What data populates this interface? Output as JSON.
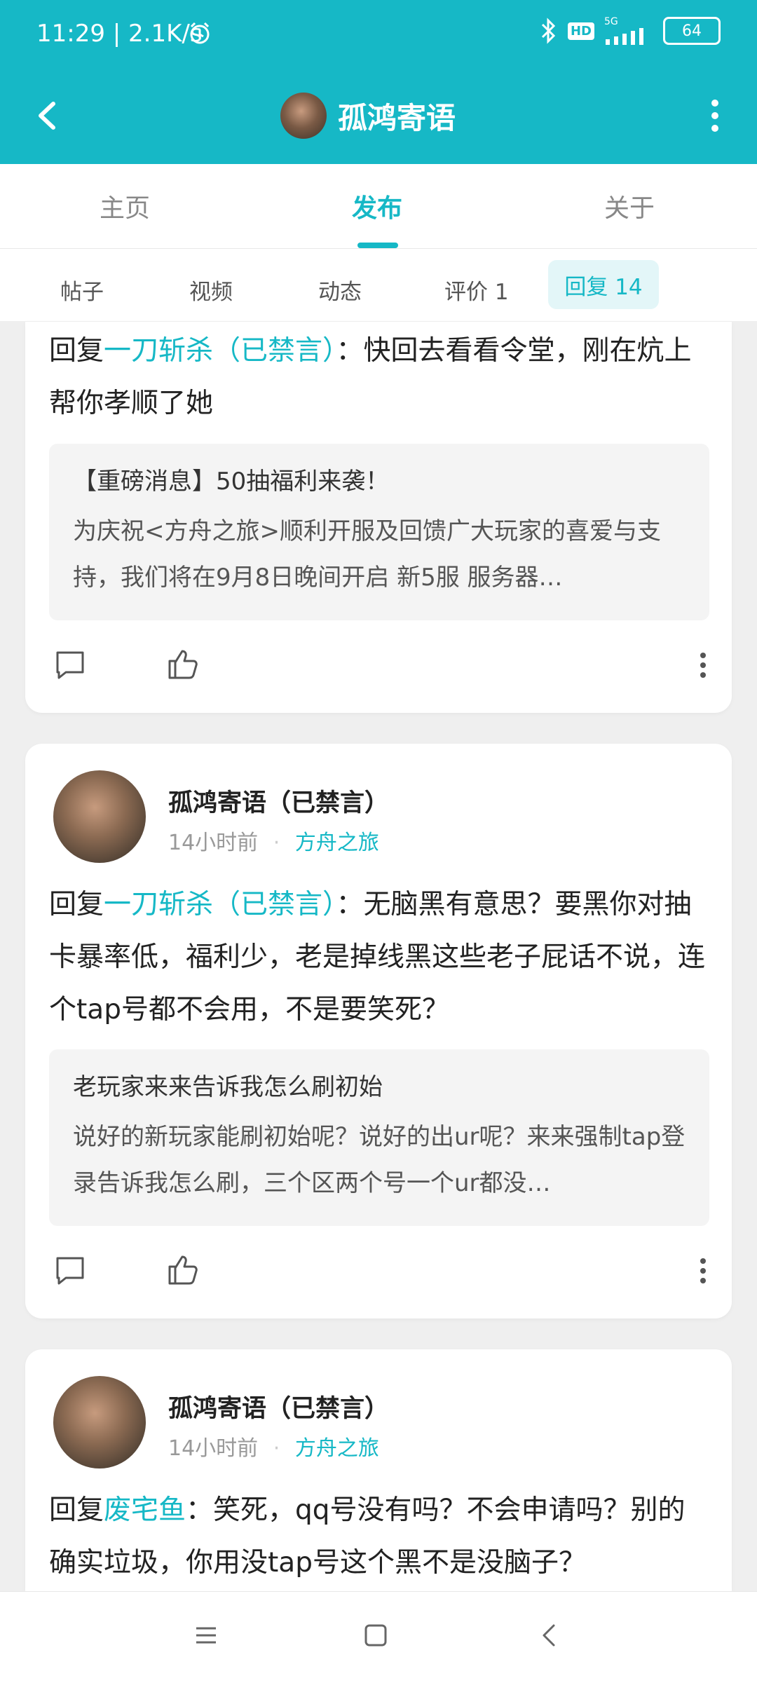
{
  "status_bar": {
    "time": "11:29 | 2.1K/s",
    "network": "5G",
    "battery": "64"
  },
  "header": {
    "title": "孤鸿寄语"
  },
  "tabs": [
    {
      "label": "主页"
    },
    {
      "label": "发布"
    },
    {
      "label": "关于"
    }
  ],
  "subtabs": [
    {
      "label": "帖子"
    },
    {
      "label": "视频"
    },
    {
      "label": "动态"
    },
    {
      "label": "评价 1"
    },
    {
      "label": "回复 14"
    }
  ],
  "posts": [
    {
      "reply_prefix": "回复",
      "reply_user": "一刀斩杀（已禁言）",
      "reply_sep": "：",
      "reply_text": "快回去看看令堂，刚在炕上帮你孝顺了她",
      "quote_title": "【重磅消息】50抽福利来袭！",
      "quote_body": "为庆祝<方舟之旅>顺利开服及回馈广大玩家的喜爱与支持，我们将在9月8日晚间开启 新5服 服务器…"
    },
    {
      "author": "孤鸿寄语（已禁言）",
      "time": "14小时前",
      "game": "方舟之旅",
      "reply_prefix": "回复",
      "reply_user": "一刀斩杀（已禁言）",
      "reply_sep": "：",
      "reply_text": "无脑黑有意思？要黑你对抽卡暴率低，福利少，老是掉线黑这些老子屁话不说，连个tap号都不会用，不是要笑死？",
      "quote_title": "老玩家来来告诉我怎么刷初始",
      "quote_body": "说好的新玩家能刷初始呢？说好的出ur呢？来来强制tap登录告诉我怎么刷，三个区两个号一个ur都没…"
    },
    {
      "author": "孤鸿寄语（已禁言）",
      "time": "14小时前",
      "game": "方舟之旅",
      "reply_prefix": "回复",
      "reply_user": "废宅鱼",
      "reply_sep": "：",
      "reply_text": "笑死，qq号没有吗？不会申请吗？别的确实垃圾，你用没tap号这个黑不是没脑子？"
    }
  ],
  "colors": {
    "accent": "#16b8c6",
    "background": "#efefef"
  }
}
